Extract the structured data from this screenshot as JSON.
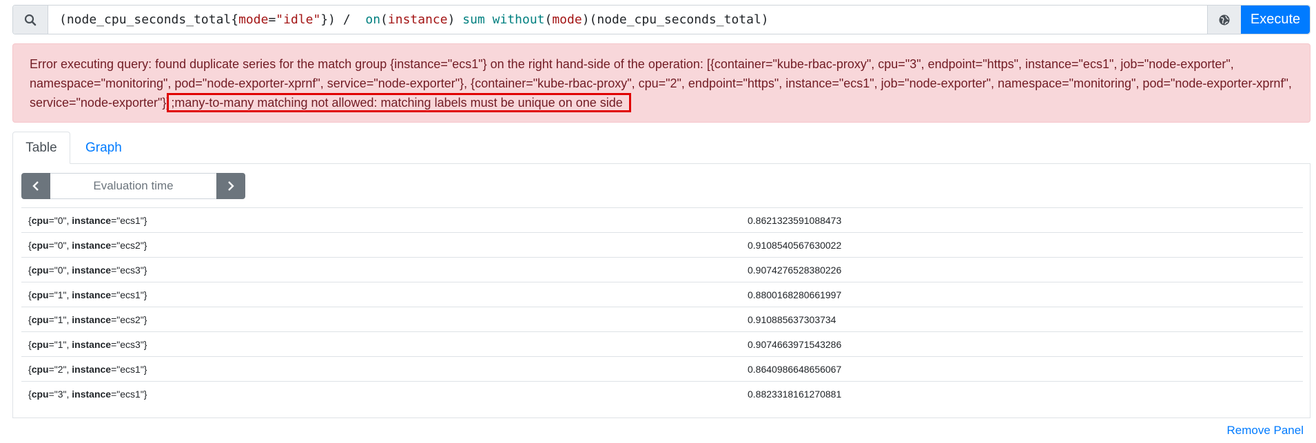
{
  "query": {
    "tokens": [
      {
        "t": "(node_cpu_seconds_total{",
        "c": ""
      },
      {
        "t": "mode",
        "c": "tok-label"
      },
      {
        "t": "=",
        "c": ""
      },
      {
        "t": "\"idle\"",
        "c": "tok-string"
      },
      {
        "t": "}) /  ",
        "c": ""
      },
      {
        "t": "on",
        "c": "tok-keyword"
      },
      {
        "t": "(",
        "c": ""
      },
      {
        "t": "instance",
        "c": "tok-label"
      },
      {
        "t": ") ",
        "c": ""
      },
      {
        "t": "sum",
        "c": "tok-func"
      },
      {
        "t": " ",
        "c": ""
      },
      {
        "t": "without",
        "c": "tok-keyword"
      },
      {
        "t": "(",
        "c": ""
      },
      {
        "t": "mode",
        "c": "tok-label"
      },
      {
        "t": ")(node_cpu_seconds_total)",
        "c": ""
      }
    ],
    "execute_label": "Execute"
  },
  "error": {
    "prefix": "Error executing query: found duplicate series for the match group {instance=\"ecs1\"} on the right hand-side of the operation: [{container=\"kube-rbac-proxy\", cpu=\"3\", endpoint=\"https\", instance=\"ecs1\", job=\"node-exporter\", namespace=\"monitoring\", pod=\"node-exporter-xprnf\", service=\"node-exporter\"}, {container=\"kube-rbac-proxy\", cpu=\"2\", endpoint=\"https\", instance=\"ecs1\", job=\"node-exporter\", namespace=\"monitoring\", pod=\"node-exporter-xprnf\", service=\"node-exporter\"}]",
    "highlight": ";many-to-many matching not allowed: matching labels must be unique on one side"
  },
  "tabs": {
    "table": "Table",
    "graph": "Graph"
  },
  "eval": {
    "placeholder": "Evaluation time"
  },
  "rows": [
    {
      "cpu": "\"0\"",
      "instance": "\"ecs1\"",
      "value": "0.8621323591088473"
    },
    {
      "cpu": "\"0\"",
      "instance": "\"ecs2\"",
      "value": "0.9108540567630022"
    },
    {
      "cpu": "\"0\"",
      "instance": "\"ecs3\"",
      "value": "0.9074276528380226"
    },
    {
      "cpu": "\"1\"",
      "instance": "\"ecs1\"",
      "value": "0.8800168280661997"
    },
    {
      "cpu": "\"1\"",
      "instance": "\"ecs2\"",
      "value": "0.910885637303734"
    },
    {
      "cpu": "\"1\"",
      "instance": "\"ecs3\"",
      "value": "0.9074663971543286"
    },
    {
      "cpu": "\"2\"",
      "instance": "\"ecs1\"",
      "value": "0.8640986648656067"
    },
    {
      "cpu": "\"3\"",
      "instance": "\"ecs1\"",
      "value": "0.8823318161270881"
    }
  ],
  "labels": {
    "cpu": "cpu",
    "instance": "instance"
  },
  "remove_label": "Remove Panel",
  "icons": {
    "search": "search-icon",
    "metrics": "globe-icon",
    "prev": "chevron-left-icon",
    "next": "chevron-right-icon"
  },
  "colors": {
    "primary": "#007bff",
    "alert_bg": "#f8d7da",
    "alert_text": "#721c24",
    "highlight_border": "#e00000"
  }
}
